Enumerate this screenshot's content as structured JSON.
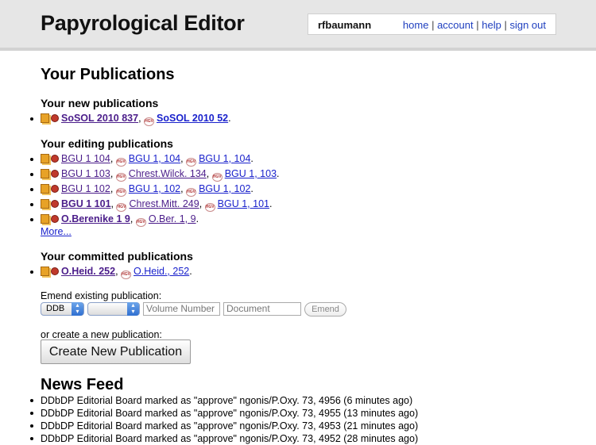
{
  "header": {
    "app_title": "Papyrological Editor",
    "username": "rfbaumann",
    "nav": [
      "home",
      "account",
      "help",
      "sign out"
    ]
  },
  "page_title": "Your Publications",
  "new_section": {
    "title": "Your new publications",
    "items": [
      {
        "parts": [
          {
            "type": "ddb",
            "text": "SoSOL 2010 837",
            "bold": true,
            "visited": true
          },
          {
            "type": "hgv",
            "text": "SoSOL 2010 52",
            "bold": true,
            "visited": false
          }
        ]
      }
    ]
  },
  "editing_section": {
    "title": "Your editing publications",
    "items": [
      {
        "parts": [
          {
            "type": "ddb",
            "text": "BGU 1 104",
            "visited": true
          },
          {
            "type": "hgv",
            "text": "BGU 1, 104",
            "visited": false
          },
          {
            "type": "hgv",
            "text": "BGU 1, 104",
            "visited": false
          }
        ]
      },
      {
        "parts": [
          {
            "type": "ddb",
            "text": "BGU 1 103",
            "visited": true
          },
          {
            "type": "hgv",
            "text": "Chrest.Wilck. 134",
            "visited": true
          },
          {
            "type": "hgv",
            "text": "BGU 1, 103",
            "visited": false
          }
        ]
      },
      {
        "parts": [
          {
            "type": "ddb",
            "text": "BGU 1 102",
            "visited": true
          },
          {
            "type": "hgv",
            "text": "BGU 1, 102",
            "visited": false
          },
          {
            "type": "hgv",
            "text": "BGU 1, 102",
            "visited": false
          }
        ]
      },
      {
        "parts": [
          {
            "type": "ddb",
            "text": "BGU 1 101",
            "visited": true,
            "bold": true
          },
          {
            "type": "hgv",
            "text": "Chrest.Mitt. 249",
            "visited": true
          },
          {
            "type": "hgv",
            "text": "BGU 1, 101",
            "visited": false
          }
        ]
      },
      {
        "parts": [
          {
            "type": "ddb",
            "text": "O.Berenike 1 9",
            "visited": true,
            "bold": true
          },
          {
            "type": "hgv",
            "text": "O.Ber. 1, 9",
            "visited": true
          }
        ]
      }
    ],
    "more_label": "More..."
  },
  "committed_section": {
    "title": "Your committed publications",
    "items": [
      {
        "parts": [
          {
            "type": "ddb",
            "text": "O.Heid. 252",
            "visited": true,
            "bold": true
          },
          {
            "type": "hgv",
            "text": "O.Heid., 252",
            "visited": false
          }
        ]
      }
    ]
  },
  "emend": {
    "label": "Emend existing publication:",
    "collection_value": "DDB",
    "volume_placeholder": "Volume Number",
    "document_placeholder": "Document Number",
    "emend_button": "Emend"
  },
  "create": {
    "label": "or create a new publication:",
    "button": "Create New Publication"
  },
  "news": {
    "title": "News Feed",
    "items": [
      "DDbDP Editorial Board marked as \"approve\" ngonis/P.Oxy. 73, 4956 (6 minutes ago)",
      "DDbDP Editorial Board marked as \"approve\" ngonis/P.Oxy. 73, 4955 (13 minutes ago)",
      "DDbDP Editorial Board marked as \"approve\" ngonis/P.Oxy. 73, 4953 (21 minutes ago)",
      "DDbDP Editorial Board marked as \"approve\" ngonis/P.Oxy. 73, 4952 (28 minutes ago)"
    ]
  }
}
